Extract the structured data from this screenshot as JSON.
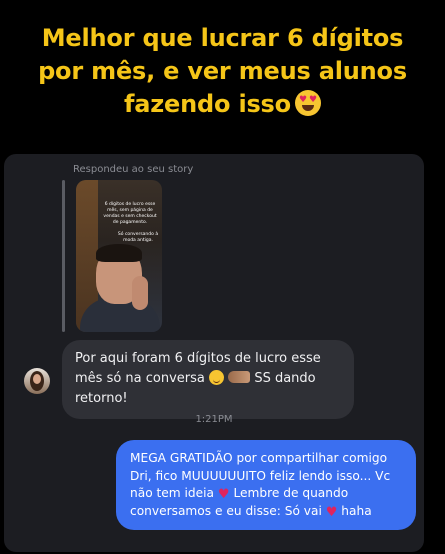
{
  "headline": {
    "line1": "Melhor que lucrar 6 dígitos",
    "line2": "por mês, e ver meus alunos",
    "line3": "fazendo isso",
    "emoji": "heart-eyes-emoji"
  },
  "chat": {
    "story_caption": "Respondeu ao seu story",
    "story": {
      "text1": "6 dígitos de lucro esse mês, sem página de vendas e sem checkout de pagamento.",
      "text2": "Só conversando à moda antiga."
    },
    "incoming": {
      "text_a": "Por aqui foram 6 dígitos de lucro esse mês",
      "text_b": "só na conversa",
      "text_c": "SS dando retorno!"
    },
    "timestamp": "1:21PM",
    "outgoing": {
      "text_a": "MEGA GRATIDÃO por compartilhar comigo Dri, fico MUUUUUUITO feliz lendo isso... Vc não tem ideia",
      "text_b": "Lembre de quando conversamos e eu disse: Só vai",
      "text_c": "haha"
    }
  },
  "colors": {
    "background": "#000000",
    "headline": "#f5c518",
    "panel": "#1c1d22",
    "incoming_bubble": "#2f3036",
    "outgoing_bubble": "#3b6ff0"
  }
}
